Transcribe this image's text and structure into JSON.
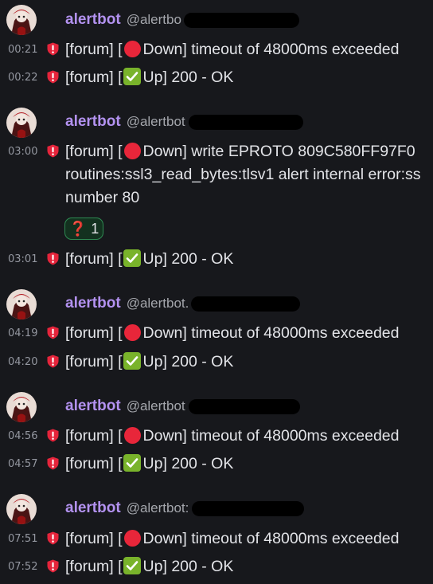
{
  "groups": [
    {
      "sender": {
        "display_name": "alertbot",
        "handle": "@alertbo"
      },
      "messages": [
        {
          "time": "00:21",
          "service": "[forum]",
          "status": "Down",
          "detail": "timeout of 48000ms exceeded"
        },
        {
          "time": "00:22",
          "service": "[forum]",
          "status": "Up",
          "detail": "200 - OK"
        }
      ]
    },
    {
      "sender": {
        "display_name": "alertbot",
        "handle": "@alertbot"
      },
      "messages": [
        {
          "time": "03:00",
          "service": "[forum]",
          "status": "Down",
          "detail": "write EPROTO 809C580FF97F0",
          "continuation": [
            "routines:ssl3_read_bytes:tlsv1 alert internal error:ss",
            "number 80"
          ],
          "reaction": {
            "emoji": "❓",
            "count": "1"
          }
        },
        {
          "time": "03:01",
          "service": "[forum]",
          "status": "Up",
          "detail": "200 - OK"
        }
      ]
    },
    {
      "sender": {
        "display_name": "alertbot",
        "handle": "@alertbot."
      },
      "messages": [
        {
          "time": "04:19",
          "service": "[forum]",
          "status": "Down",
          "detail": "timeout of 48000ms exceeded"
        },
        {
          "time": "04:20",
          "service": "[forum]",
          "status": "Up",
          "detail": "200 - OK"
        }
      ]
    },
    {
      "sender": {
        "display_name": "alertbot",
        "handle": "@alertbot"
      },
      "messages": [
        {
          "time": "04:56",
          "service": "[forum]",
          "status": "Down",
          "detail": "timeout of 48000ms exceeded"
        },
        {
          "time": "04:57",
          "service": "[forum]",
          "status": "Up",
          "detail": "200 - OK"
        }
      ]
    },
    {
      "sender": {
        "display_name": "alertbot",
        "handle": "@alertbot:"
      },
      "messages": [
        {
          "time": "07:51",
          "service": "[forum]",
          "status": "Down",
          "detail": "timeout of 48000ms exceeded"
        },
        {
          "time": "07:52",
          "service": "[forum]",
          "status": "Up",
          "detail": "200 - OK"
        }
      ]
    }
  ],
  "colors": {
    "background": "#17181c",
    "display_name": "#b392f0",
    "alert_icon": "#e5243b",
    "status_down": "#e8263a",
    "status_up": "#79b32b",
    "reaction_border": "#2e8a52"
  },
  "icons": {
    "alert": "shield-exclamation-icon",
    "down": "red-circle-emoji",
    "up": "check-mark-button-emoji"
  }
}
